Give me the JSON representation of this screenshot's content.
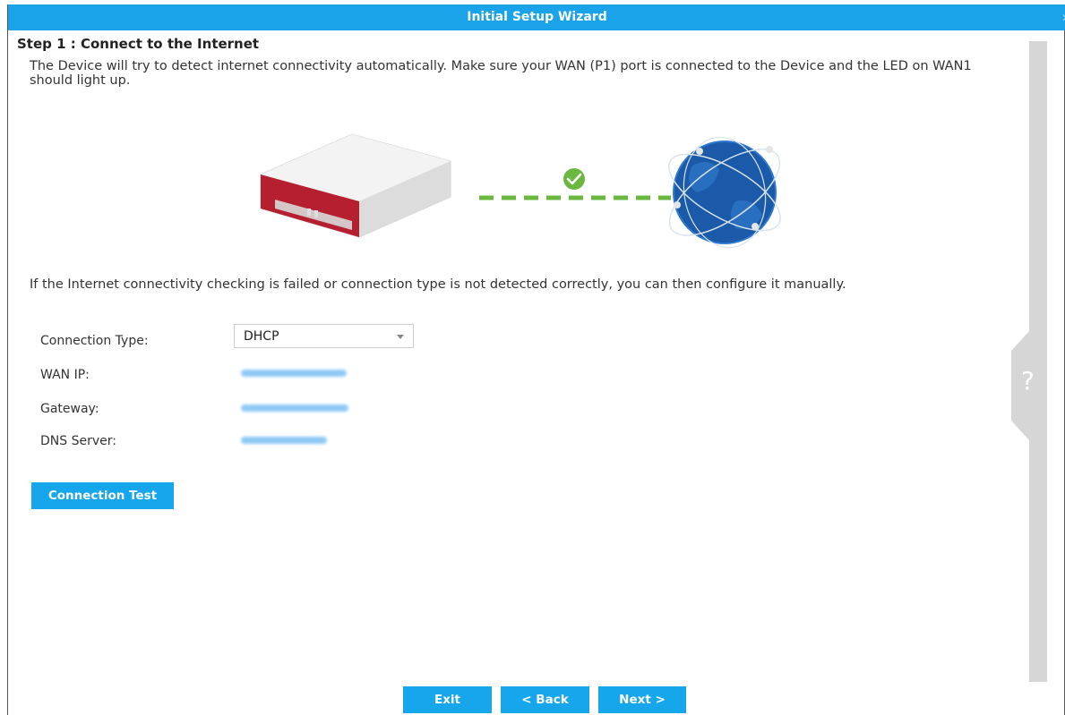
{
  "window": {
    "title": "Initial Setup Wizard",
    "close_icon": "close-icon"
  },
  "step": {
    "title": "Step 1 : Connect to the Internet",
    "intro": "The Device will try to detect internet connectivity automatically. Make sure your WAN (P1) port is connected to the Device and the LED on WAN1 should light up.",
    "manual_note": "If the Internet connectivity checking is failed or connection type is not detected correctly, you can then configure it manually."
  },
  "illustration": {
    "icons": [
      "router-device-icon",
      "check-icon",
      "globe-icon"
    ],
    "colors": {
      "device_red": "#b51f2f",
      "link_green": "#6ab83f",
      "globe_blue": "#1b5aa8"
    }
  },
  "form": {
    "connection_type": {
      "label": "Connection Type:",
      "value": "DHCP"
    },
    "wan_ip": {
      "label": "WAN IP:"
    },
    "gateway": {
      "label": "Gateway:"
    },
    "dns_server": {
      "label": "DNS Server:"
    },
    "test_button": "Connection Test"
  },
  "footer": {
    "exit": "Exit",
    "back": "< Back",
    "next": "Next >"
  },
  "help": {
    "glyph": "?"
  },
  "colors": {
    "accent": "#1aa3e8",
    "button": "#16a6ec",
    "sidebar": "#d6d6d6"
  }
}
